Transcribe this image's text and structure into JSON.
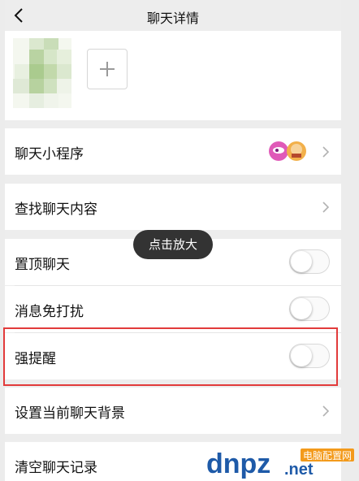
{
  "header": {
    "title": "聊天详情"
  },
  "members": {
    "add_label": "+"
  },
  "rows": {
    "mini_programs": {
      "label": "聊天小程序"
    },
    "search_history": {
      "label": "查找聊天内容"
    },
    "pin_chat": {
      "label": "置顶聊天",
      "toggle_on": false
    },
    "mute": {
      "label": "消息免打扰",
      "toggle_on": false
    },
    "strong_reminder": {
      "label": "强提醒",
      "toggle_on": false
    },
    "set_background": {
      "label": "设置当前聊天背景"
    },
    "clear_history": {
      "label": "清空聊天记录"
    }
  },
  "tooltip": {
    "text": "点击放大"
  },
  "watermark": {
    "brand": "dnpz",
    "suffix": ".net",
    "tag": "电脑配置网"
  },
  "colors": {
    "highlight": "#e23b3b",
    "background": "#ededed",
    "watermark_blue": "#1e5aa8",
    "watermark_orange": "#f39a1b"
  }
}
